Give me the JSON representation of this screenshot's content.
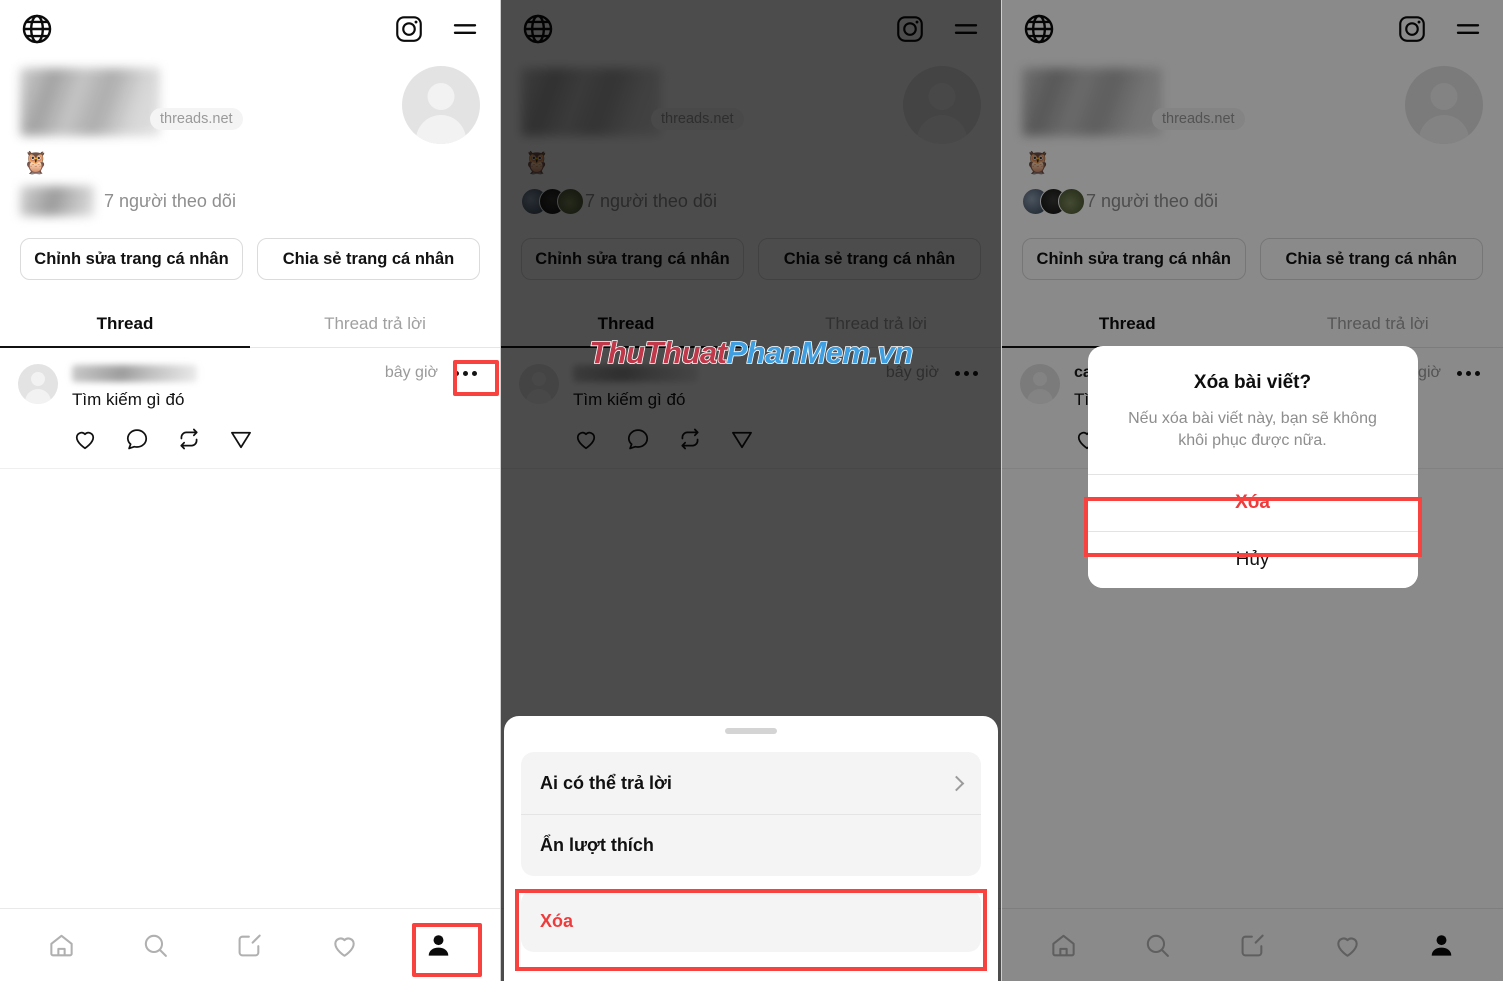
{
  "app": {
    "handle_chip": "threads.net",
    "bio_emoji": "🦉",
    "followers_text": "7 người theo dõi",
    "edit_profile_label": "Chỉnh sửa trang cá nhân",
    "share_profile_label": "Chia sẻ trang cá nhân"
  },
  "tabs": {
    "thread": "Thread",
    "thread_replies": "Thread trả lời"
  },
  "post": {
    "username_partial": "ca",
    "time": "bây giờ",
    "text": "Tìm kiếm gì đó",
    "text_partial": "Tì",
    "icons": {
      "like": "heart-icon",
      "comment": "comment-icon",
      "repost": "repost-icon",
      "share": "send-icon"
    },
    "more_label": "•••"
  },
  "header_icons": {
    "globe": "globe-icon",
    "instagram": "instagram-icon",
    "menu": "hamburger-menu-icon"
  },
  "bottom_nav": [
    {
      "name": "home-icon",
      "active": false
    },
    {
      "name": "search-icon",
      "active": false
    },
    {
      "name": "compose-icon",
      "active": false
    },
    {
      "name": "activity-heart-icon",
      "active": false
    },
    {
      "name": "profile-icon",
      "active": true
    }
  ],
  "sheet": {
    "items": [
      {
        "label": "Ai có thể trả lời",
        "has_chevron": true,
        "destructive": false
      },
      {
        "label": "Ẩn lượt thích",
        "has_chevron": false,
        "destructive": false
      }
    ],
    "delete_label": "Xóa"
  },
  "alert": {
    "title": "Xóa bài viết?",
    "message": "Nếu xóa bài viết này, bạn sẽ không khôi phục được nữa.",
    "confirm_label": "Xóa",
    "cancel_label": "Hủy"
  },
  "watermark": {
    "part1": "ThuThuat",
    "part2": "PhanMem.vn"
  },
  "colors": {
    "highlight": "#f8423f",
    "destructive": "#ef3b3b",
    "muted": "#8e8e8e",
    "watermark_red": "#c0394b",
    "watermark_blue": "#3f9fe0"
  }
}
